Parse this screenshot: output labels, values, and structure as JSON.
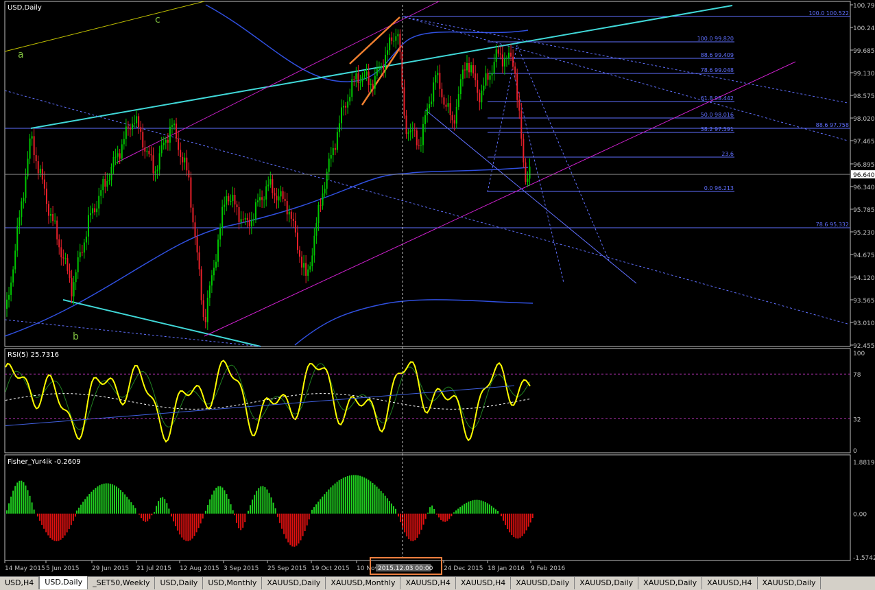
{
  "chart_data": {
    "type": "line",
    "title": "USD,Daily",
    "indicators": {
      "rsi_label": "RSI(5) 25.7316",
      "fisher_label": "Fisher_Yur4ik -0.2609"
    },
    "price_axis": [
      "100.795",
      "100.240",
      "99.685",
      "99.130",
      "98.575",
      "98.020",
      "97.465",
      "96.895",
      "96.340",
      "95.785",
      "95.230",
      "94.675",
      "94.120",
      "93.565",
      "93.010",
      "92.455"
    ],
    "current_price": "96.640",
    "rsi_axis": [
      "100",
      "78",
      "32",
      "0"
    ],
    "fisher_axis": [
      "1.8819",
      "0.00",
      "-1.5742"
    ],
    "date_axis": [
      "14 May 2015",
      "5 Jun 2015",
      "29 Jun 2015",
      "21 Jul 2015",
      "12 Aug 2015",
      "3 Sep 2015",
      "25 Sep 2015",
      "19 Oct 2015",
      "10 Nov 2015",
      "24 Dec 2015",
      "18 Jan 2016",
      "9 Feb 2016"
    ],
    "crosshair_date": "2015.12.03 00:00",
    "fib_levels": [
      {
        "label": "100.0 100.522"
      },
      {
        "label": "100.0 99.820"
      },
      {
        "label": "88.6 99.409"
      },
      {
        "label": "78.6 99.048"
      },
      {
        "label": "61.8 98.442"
      },
      {
        "label": "50.0 98.016"
      },
      {
        "label": "88.6 97.758"
      },
      {
        "label": "38.2 97.591"
      },
      {
        "label": "23.6"
      },
      {
        "label": "0.0 96.213"
      },
      {
        "label": "78.6 95.332"
      }
    ],
    "wave_labels": [
      "a",
      "b",
      "c"
    ],
    "colors": {
      "bull": "#00c800",
      "bear": "#e8202a",
      "trend": "#40d8d8",
      "channel": "#d020d0",
      "ma": "#3050e0",
      "rsi": "#ffff00",
      "axis": "#c0c0c0",
      "fib": "#6070ff"
    }
  },
  "tabs": [
    {
      "label": "USD,H4"
    },
    {
      "label": "USD,Daily",
      "active": true
    },
    {
      "label": "_SET50,Weekly"
    },
    {
      "label": "USD,Daily"
    },
    {
      "label": "USD,Monthly"
    },
    {
      "label": "XAUUSD,Daily"
    },
    {
      "label": "XAUUSD,Monthly"
    },
    {
      "label": "XAUUSD,H4"
    },
    {
      "label": "XAUUSD,H4"
    },
    {
      "label": "XAUUSD,Daily"
    },
    {
      "label": "XAUUSD,Daily"
    },
    {
      "label": "XAUUSD,Daily"
    },
    {
      "label": "XAUUSD,H4"
    },
    {
      "label": "XAUUSD,Daily"
    }
  ]
}
